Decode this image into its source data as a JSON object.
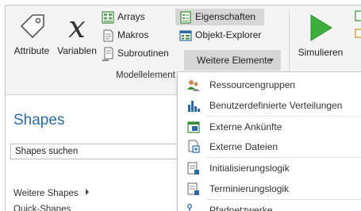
{
  "ribbon": {
    "attribute_label": "Attribute",
    "variablen_label": "Variablen",
    "arrays_label": "Arrays",
    "makros_label": "Makros",
    "subroutinen_label": "Subroutinen",
    "eigenschaften_label": "Eigenschaften",
    "objekt_explorer_label": "Objekt-Explorer",
    "weitere_elemente_label": "Weitere Elemente",
    "simulieren_label": "Simulieren",
    "group_label": "Modellelement"
  },
  "shapes_pane": {
    "title": "Shapes",
    "search_placeholder": "Shapes suchen",
    "weitere_shapes": "Weitere Shapes",
    "quick_shapes": "Quick-Shapes"
  },
  "dropdown": {
    "items": [
      {
        "label": "Ressourcengruppen",
        "icon": "resource-groups-icon"
      },
      {
        "label": "Benutzerdefinierte Verteilungen",
        "icon": "custom-distributions-icon"
      },
      {
        "label": "Externe Ankünfte",
        "icon": "external-arrivals-icon"
      },
      {
        "label": "Externe Dateien",
        "icon": "external-files-icon"
      },
      {
        "label": "Initialisierungslogik",
        "icon": "initialization-logic-icon"
      },
      {
        "label": "Terminierungslogik",
        "icon": "termination-logic-icon"
      },
      {
        "label": "Pfadnetzwerke",
        "icon": "path-networks-icon"
      }
    ]
  },
  "colors": {
    "accent_blue": "#2b6aa6",
    "play_green": "#3cae3c",
    "ribbon_bg": "#f3f3f3",
    "highlight_bg": "#d6d6d6"
  }
}
